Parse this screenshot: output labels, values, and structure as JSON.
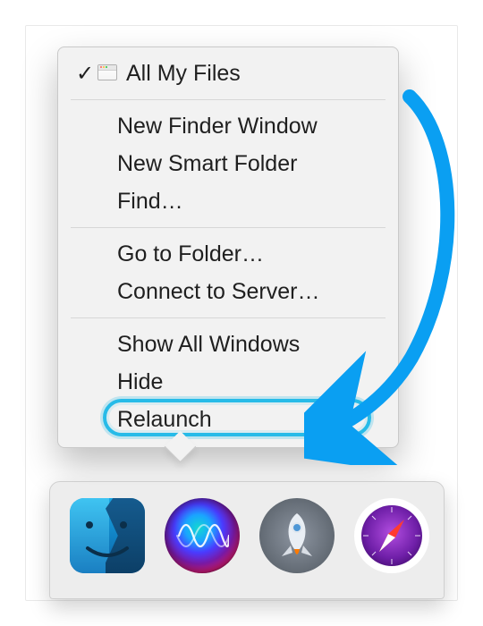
{
  "menu": {
    "current": {
      "label": "All My Files",
      "checked": true
    },
    "group1": [
      "New Finder Window",
      "New Smart Folder",
      "Find…"
    ],
    "group2": [
      "Go to Folder…",
      "Connect to Server…"
    ],
    "group3": [
      "Show All Windows",
      "Hide",
      "Relaunch"
    ],
    "highlighted_item": "Relaunch"
  },
  "dock": {
    "items": [
      {
        "name": "Finder",
        "running": true
      },
      {
        "name": "Siri",
        "running": false
      },
      {
        "name": "Launchpad",
        "running": false
      },
      {
        "name": "Safari",
        "running": false
      }
    ]
  },
  "annotation": {
    "arrow_target": "Relaunch"
  },
  "colors": {
    "highlight": "#27bbe8",
    "arrow": "#0a9ff2"
  }
}
